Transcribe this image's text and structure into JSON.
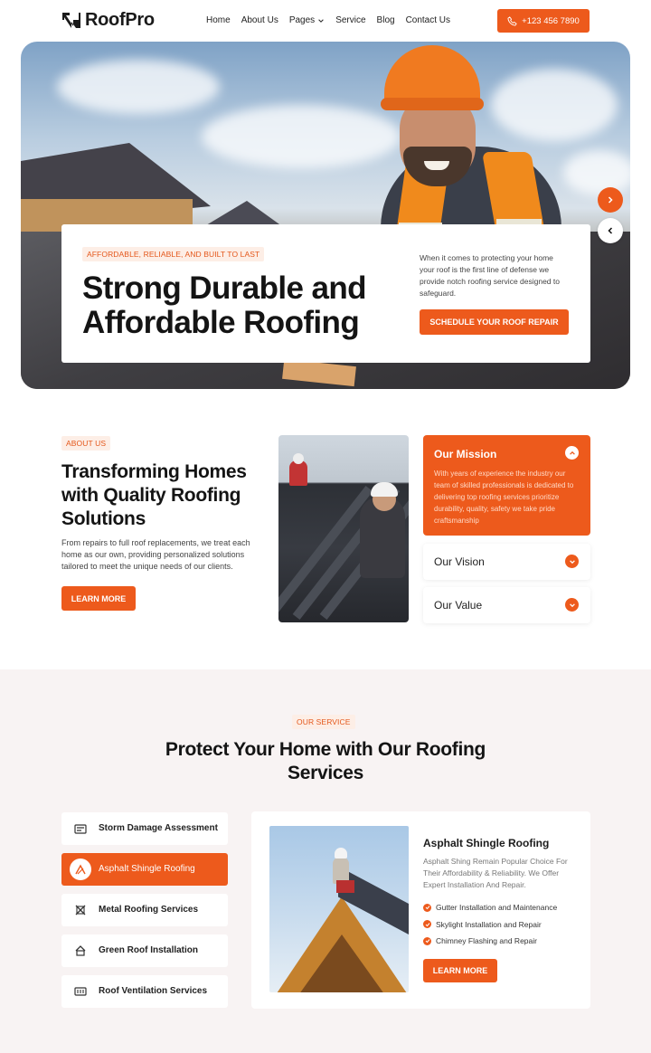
{
  "brand": {
    "name": "RoofPro",
    "accent": "#ed5a1c"
  },
  "nav": {
    "items": [
      "Home",
      "About Us",
      "Pages",
      "Service",
      "Blog",
      "Contact Us"
    ],
    "phone": "+123 456 7890"
  },
  "hero": {
    "tag": "AFFORDABLE, RELIABLE, AND BUILT TO LAST",
    "title": "Strong Durable and Affordable Roofing",
    "description": "When it comes to protecting your home your roof is the first line of defense we provide notch roofing service designed to safeguard.",
    "button": "SCHEDULE YOUR ROOF REPAIR"
  },
  "about": {
    "tag": "ABOUT US",
    "title": "Transforming Homes with Quality Roofing Solutions",
    "description": "From repairs to full roof replacements, we treat each home as our own, providing personalized solutions tailored to meet the unique needs of our clients.",
    "button": "LEARN MORE",
    "accordion": [
      {
        "title": "Our Mission",
        "text": "With years of experience the industry our team of skilled professionals is dedicated to delivering top roofing services prioritize durability, quality, safety we take pride craftsmanship",
        "expanded": true
      },
      {
        "title": "Our Vision",
        "expanded": false
      },
      {
        "title": "Our Value",
        "expanded": false
      }
    ]
  },
  "services": {
    "tag": "OUR SERVICE",
    "title": "Protect Your Home with Our Roofing Services",
    "items": [
      {
        "label": "Storm Damage Assessment",
        "icon": "storm-damage-icon",
        "active": false
      },
      {
        "label": "Asphalt Shingle Roofing",
        "icon": "shingle-roofing-icon",
        "active": true
      },
      {
        "label": "Metal Roofing Services",
        "icon": "metal-roofing-icon",
        "active": false
      },
      {
        "label": "Green Roof Installation",
        "icon": "green-roof-icon",
        "active": false
      },
      {
        "label": "Roof Ventilation Services",
        "icon": "ventilation-icon",
        "active": false
      }
    ],
    "detail": {
      "title": "Asphalt Shingle Roofing",
      "description": "Asphalt Shing Remain Popular Choice For Their Affordability & Reliability. We Offer Expert Installation And Repair.",
      "features": [
        "Gutter Installation and Maintenance",
        "Skylight Installation and Repair",
        "Chimney Flashing and Repair"
      ],
      "button": "LEARN MORE"
    }
  }
}
